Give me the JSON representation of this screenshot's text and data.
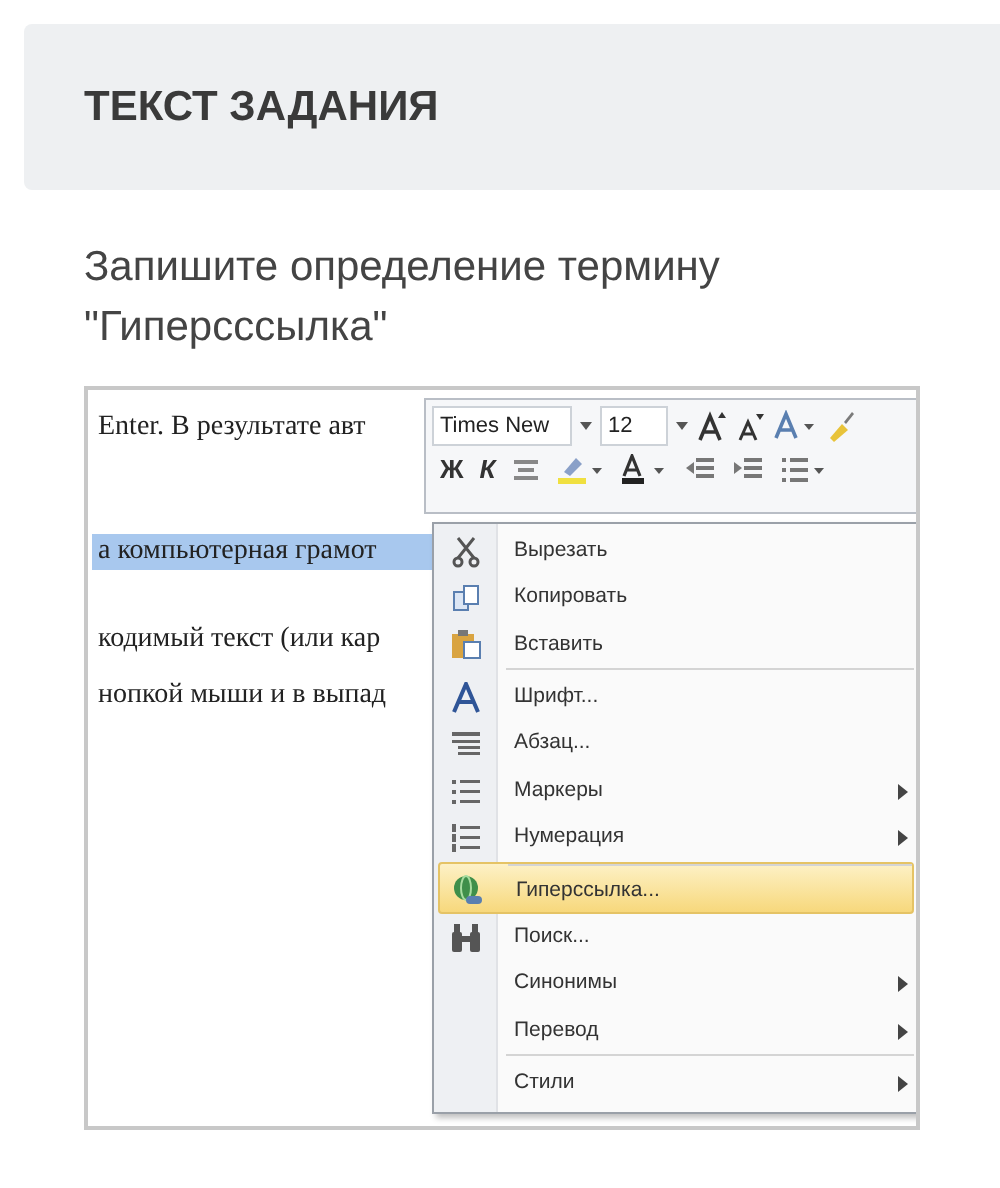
{
  "task_header": {
    "title": "ТЕКСТ ЗАДАНИЯ"
  },
  "question": "Запишите определение термину \"Гиперсссылка\"",
  "screenshot": {
    "document_lines": [
      {
        "text": "Enter. В результате авт",
        "selected": false
      },
      {
        "text": "а компьютерная грамот",
        "selected": true
      },
      {
        "text": "кодимый текст (или кар",
        "selected": false
      },
      {
        "text": "нопкой мыши и в выпад",
        "selected": false
      }
    ],
    "mini_toolbar": {
      "font": "Times New",
      "size": "12",
      "bold_label": "Ж",
      "italic_label": "К"
    },
    "context_menu": [
      {
        "label": "Вырезать",
        "kind": "cut",
        "submenu": false,
        "selected": false,
        "divider_before": false
      },
      {
        "label": "Копировать",
        "kind": "copy",
        "submenu": false,
        "selected": false,
        "divider_before": false
      },
      {
        "label": "Вставить",
        "kind": "paste",
        "submenu": false,
        "selected": false,
        "divider_before": false
      },
      {
        "label": "Шрифт...",
        "kind": "font",
        "submenu": false,
        "selected": false,
        "divider_before": true
      },
      {
        "label": "Абзац...",
        "kind": "paragraph",
        "submenu": false,
        "selected": false,
        "divider_before": false
      },
      {
        "label": "Маркеры",
        "kind": "bullets",
        "submenu": true,
        "selected": false,
        "divider_before": false
      },
      {
        "label": "Нумерация",
        "kind": "numbering",
        "submenu": true,
        "selected": false,
        "divider_before": false
      },
      {
        "label": "Гиперссылка...",
        "kind": "hyperlink",
        "submenu": false,
        "selected": true,
        "divider_before": true
      },
      {
        "label": "Поиск...",
        "kind": "search",
        "submenu": false,
        "selected": false,
        "divider_before": false
      },
      {
        "label": "Синонимы",
        "kind": "plain",
        "submenu": true,
        "selected": false,
        "divider_before": false
      },
      {
        "label": "Перевод",
        "kind": "plain",
        "submenu": true,
        "selected": false,
        "divider_before": false
      },
      {
        "label": "Стили",
        "kind": "plain",
        "submenu": true,
        "selected": false,
        "divider_before": true
      }
    ]
  }
}
